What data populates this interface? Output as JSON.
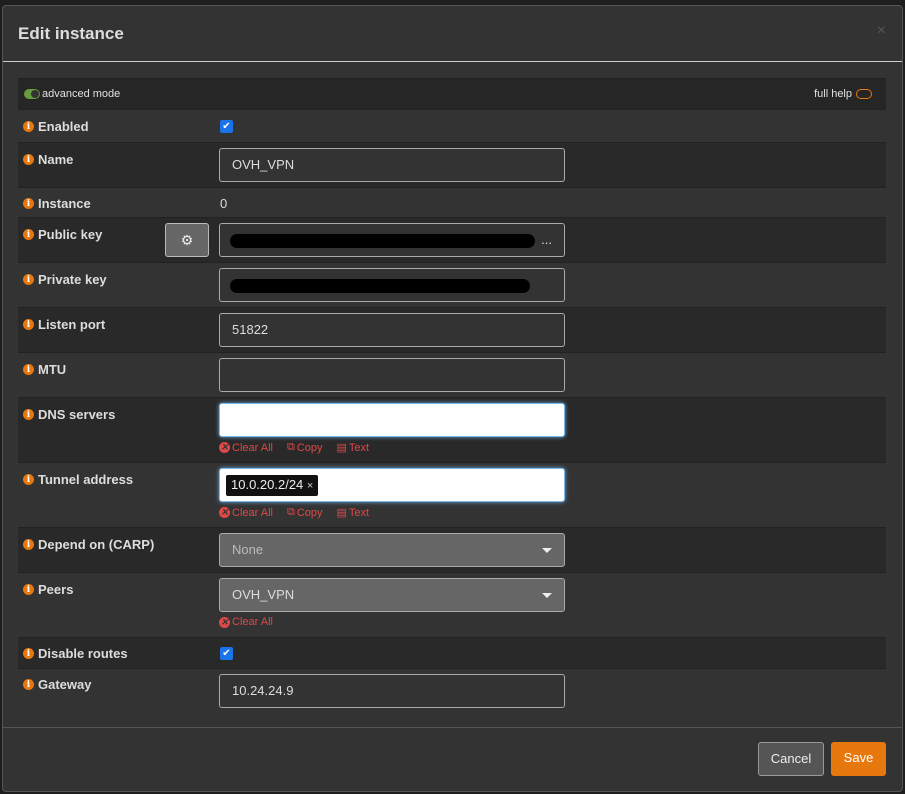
{
  "modal": {
    "title": "Edit instance",
    "close_icon": "×"
  },
  "toolbar": {
    "advanced_mode": "advanced mode",
    "full_help": "full help"
  },
  "fields": {
    "enabled": {
      "label": "Enabled",
      "checked": true
    },
    "name": {
      "label": "Name",
      "value": "OVH_VPN"
    },
    "instance": {
      "label": "Instance",
      "value": "0"
    },
    "public_key": {
      "label": "Public key",
      "ellipsis": "..."
    },
    "private_key": {
      "label": "Private key"
    },
    "listen_port": {
      "label": "Listen port",
      "value": "51822"
    },
    "mtu": {
      "label": "MTU",
      "value": ""
    },
    "dns_servers": {
      "label": "DNS servers",
      "value": ""
    },
    "tunnel_address": {
      "label": "Tunnel address",
      "tag": "10.0.20.2/24"
    },
    "depend_on": {
      "label": "Depend on (CARP)",
      "value": "None"
    },
    "peers": {
      "label": "Peers",
      "value": "OVH_VPN"
    },
    "disable_routes": {
      "label": "Disable routes",
      "checked": true
    },
    "gateway": {
      "label": "Gateway",
      "value": "10.24.24.9"
    }
  },
  "tools": {
    "clear_all": "Clear All",
    "copy": "Copy",
    "text": "Text"
  },
  "footer": {
    "cancel": "Cancel",
    "save": "Save"
  },
  "colors": {
    "accent": "#e6780e",
    "danger": "#e04848",
    "checkbox": "#1a73e8"
  }
}
